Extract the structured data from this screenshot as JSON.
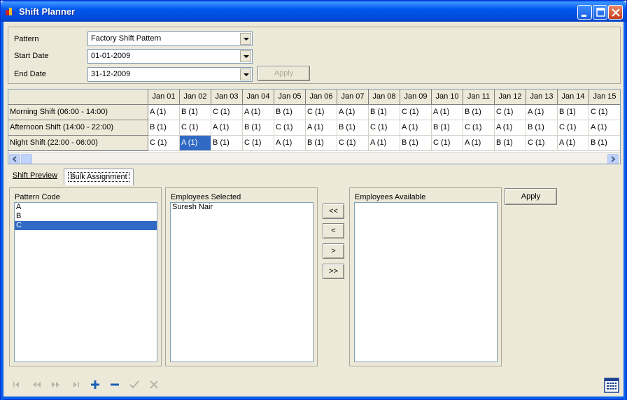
{
  "window": {
    "title": "Shift Planner"
  },
  "filters": {
    "pattern_label": "Pattern",
    "pattern_value": "Factory Shift Pattern",
    "start_label": "Start Date",
    "start_value": "01-01-2009",
    "end_label": "End Date",
    "end_value": "31-12-2009",
    "apply_label": "Apply"
  },
  "grid": {
    "columns": [
      "Jan 01",
      "Jan 02",
      "Jan 03",
      "Jan 04",
      "Jan 05",
      "Jan 06",
      "Jan 07",
      "Jan 08",
      "Jan 09",
      "Jan 10",
      "Jan 11",
      "Jan 12",
      "Jan 13",
      "Jan 14",
      "Jan 15"
    ],
    "rows": [
      {
        "label": "Morning Shift (06:00 - 14:00)",
        "cells": [
          "A (1)",
          "B (1)",
          "C (1)",
          "A (1)",
          "B (1)",
          "C (1)",
          "A (1)",
          "B (1)",
          "C (1)",
          "A (1)",
          "B (1)",
          "C (1)",
          "A (1)",
          "B (1)",
          "C (1)"
        ]
      },
      {
        "label": "Afternoon Shift (14:00 - 22:00)",
        "cells": [
          "B (1)",
          "C (1)",
          "A (1)",
          "B (1)",
          "C (1)",
          "A (1)",
          "B (1)",
          "C (1)",
          "A (1)",
          "B (1)",
          "C (1)",
          "A (1)",
          "B (1)",
          "C (1)",
          "A (1)"
        ]
      },
      {
        "label": "Night Shift (22:00 - 06:00)",
        "cells": [
          "C (1)",
          "A (1)",
          "B (1)",
          "C (1)",
          "A (1)",
          "B (1)",
          "C (1)",
          "A (1)",
          "B (1)",
          "C (1)",
          "A (1)",
          "B (1)",
          "C (1)",
          "A (1)",
          "B (1)"
        ]
      }
    ],
    "selected_cell": {
      "row": 2,
      "col": 1
    }
  },
  "tabs": [
    {
      "label": "Shift Preview",
      "active": false
    },
    {
      "label": "Bulk Assignment",
      "active": true
    }
  ],
  "bulk": {
    "pattern_code_label": "Pattern Code",
    "pattern_codes": [
      "A",
      "B",
      "C"
    ],
    "selected_code_index": 2,
    "employees_selected_label": "Employees Selected",
    "employees_selected": [
      "Suresh Nair"
    ],
    "employees_available_label": "Employees Available",
    "employees_available": [],
    "move_all_left": "<<",
    "move_left": "<",
    "move_right": ">",
    "move_all_right": ">>",
    "apply_label": "Apply"
  },
  "colors": {
    "selection": "#316ac5",
    "titlebar": "#0058ee",
    "nav_accent": "#1c5fb5"
  }
}
